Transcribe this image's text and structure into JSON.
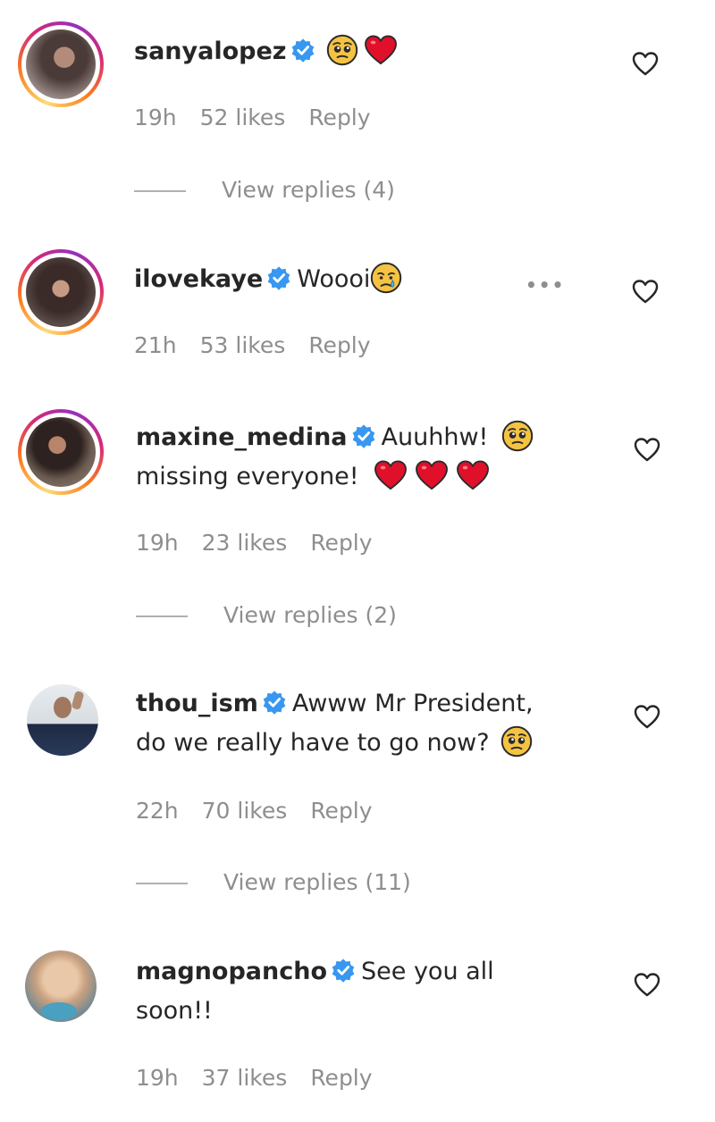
{
  "comments": [
    {
      "username": "sanyalopez",
      "text": "",
      "time": "19h",
      "likes": "52 likes",
      "reply": "Reply",
      "view_replies": "View replies (4)",
      "emojis": [
        "pleading-face-emoji",
        "red-heart-emoji"
      ]
    },
    {
      "username": "ilovekaye",
      "text": "Woooi",
      "time": "21h",
      "likes": "53 likes",
      "reply": "Reply",
      "emojis": [
        "crying-face-emoji"
      ],
      "more_icon": "•••"
    },
    {
      "username": "maxine_medina",
      "text": "Auuhhw!",
      "text2": "missing everyone!",
      "time": "19h",
      "likes": "23 likes",
      "reply": "Reply",
      "view_replies": "View replies (2)",
      "emojis": [
        "pleading-face-emoji",
        "red-heart-emoji",
        "red-heart-emoji",
        "red-heart-emoji"
      ]
    },
    {
      "username": "thou_ism",
      "text": "Awww Mr President,",
      "text2": "do we really have to go now?",
      "time": "22h",
      "likes": "70 likes",
      "reply": "Reply",
      "view_replies": "View replies (11)",
      "emojis": [
        "pleading-face-emoji"
      ]
    },
    {
      "username": "magnopancho",
      "text": "See you all",
      "text2": "soon!!",
      "time": "19h",
      "likes": "37 likes",
      "reply": "Reply"
    }
  ],
  "colors": {
    "verified": "#3897f0",
    "meta": "#8e8e8e",
    "heart_red": "#e0102a",
    "emoji_yellow": "#f5c342"
  }
}
